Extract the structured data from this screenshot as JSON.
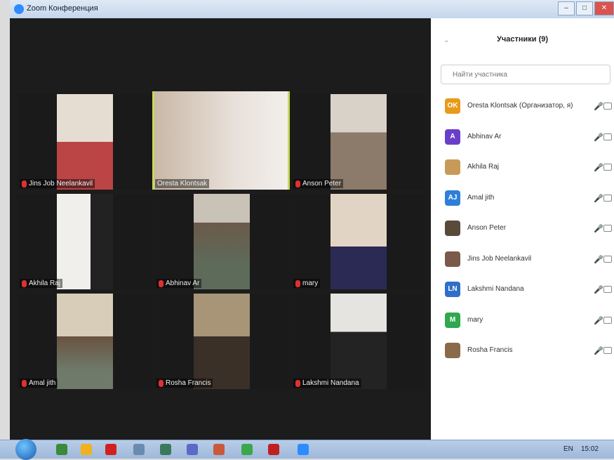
{
  "window": {
    "title": "Zoom Конференция"
  },
  "tiles": [
    {
      "name": "Jins Job Neelankavil",
      "muted": true,
      "bg": "#b44",
      "active": false
    },
    {
      "name": "Oresta Klontsak",
      "muted": false,
      "bg": "#c9b8a6",
      "active": true
    },
    {
      "name": "Anson Peter",
      "muted": true,
      "bg": "#8c7a6a",
      "active": false
    },
    {
      "name": "Akhila Raj",
      "muted": true,
      "bg": "#ece9e6",
      "active": false
    },
    {
      "name": "Abhinav Ar",
      "muted": true,
      "bg": "#6b5a4a",
      "active": false
    },
    {
      "name": "mary",
      "muted": true,
      "bg": "#c7a48c",
      "active": false
    },
    {
      "name": "Amal jith",
      "muted": true,
      "bg": "#c9b99e",
      "active": false
    },
    {
      "name": "Rosha Francis",
      "muted": true,
      "bg": "#a89577",
      "active": false
    },
    {
      "name": "Lakshmi Nandana",
      "muted": true,
      "bg": "#e6e4e1",
      "active": false
    }
  ],
  "panel": {
    "title": "Участники (9)",
    "search_placeholder": "Найти участника",
    "participants": [
      {
        "initials": "OK",
        "color": "#e89a1a",
        "name": "Oresta Klontsak (Организатор, я)",
        "mic_on": true
      },
      {
        "initials": "A",
        "color": "#6a3fc8",
        "name": "Abhinav Ar",
        "mic_on": false
      },
      {
        "initials": "",
        "color": "#c89a5a",
        "name": "Akhila Raj",
        "mic_on": false
      },
      {
        "initials": "AJ",
        "color": "#2f7fd8",
        "name": "Amal jith",
        "mic_on": false
      },
      {
        "initials": "",
        "color": "#5a4a3a",
        "name": "Anson Peter",
        "mic_on": false
      },
      {
        "initials": "",
        "color": "#7a5a4a",
        "name": "Jins Job Neelankavil",
        "mic_on": false
      },
      {
        "initials": "LN",
        "color": "#2f6fc8",
        "name": "Lakshmi Nandana",
        "mic_on": false
      },
      {
        "initials": "M",
        "color": "#2fa84f",
        "name": "mary",
        "mic_on": false
      },
      {
        "initials": "",
        "color": "#8a6a4a",
        "name": "Rosha Francis",
        "mic_on": false
      }
    ]
  },
  "taskbar": {
    "clock": "15:02",
    "lang": "EN"
  },
  "icons": {
    "minimize": "–",
    "maximize": "□",
    "close": "✕",
    "chevron": "⌄",
    "mic": "🎤"
  }
}
